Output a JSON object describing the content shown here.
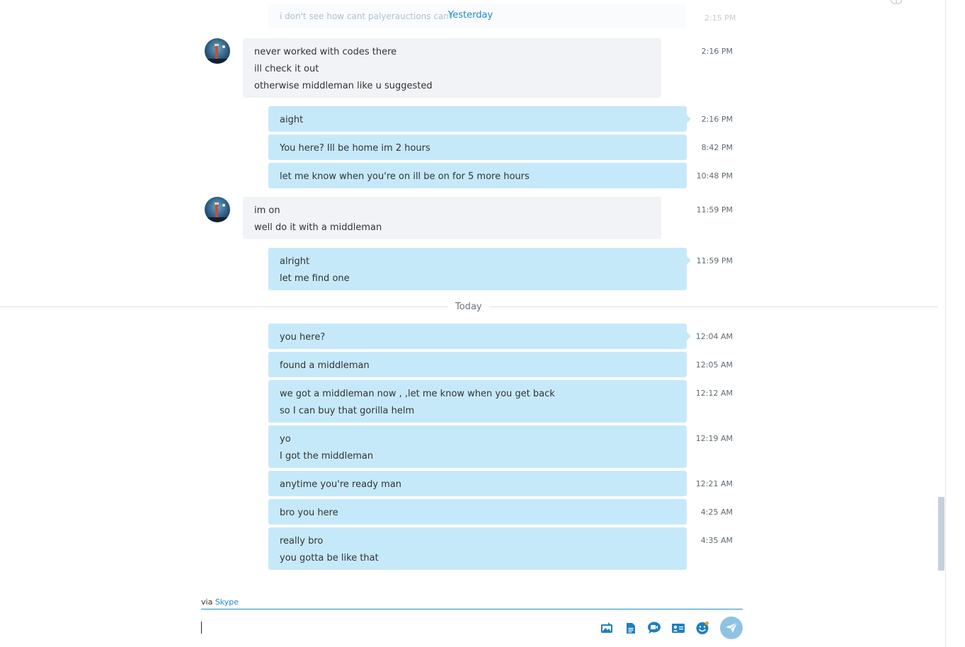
{
  "colors": {
    "accent": "#1b8dc9",
    "outgoing_bubble": "#c6e9fa",
    "incoming_bubble": "#f1f3f6",
    "send_button": "#8ec3e3"
  },
  "top_partial": {
    "faded_text": "i don't see how cant palyerauctions cant",
    "faded_time": "2:15 PM"
  },
  "dividers": {
    "yesterday": "Yesterday",
    "today": "Today"
  },
  "messages": [
    {
      "lines": [
        "never worked with codes there",
        "ill check it out",
        "otherwise middleman like u suggested"
      ],
      "time": "2:16 PM"
    },
    {
      "lines": [
        "aight"
      ],
      "time": "2:16 PM"
    },
    {
      "lines": [
        "You here? Ill be home im 2 hours"
      ],
      "time": "8:42 PM"
    },
    {
      "lines": [
        "let me know when you're on ill be on for 5 more hours"
      ],
      "time": "10:48 PM"
    },
    {
      "lines": [
        "im on",
        "well do it with a middleman"
      ],
      "time": "11:59 PM"
    },
    {
      "lines": [
        "alright",
        "let me find one"
      ],
      "time": "11:59 PM"
    },
    {
      "lines": [
        "you here?"
      ],
      "time": "12:04 AM"
    },
    {
      "lines": [
        "found a middleman"
      ],
      "time": "12:05 AM"
    },
    {
      "lines": [
        "we got a middleman now , ,let me know when you get back",
        "so I can buy that gorilla helm"
      ],
      "time": "12:12 AM"
    },
    {
      "lines": [
        "yo",
        "I got the middleman"
      ],
      "time": "12:19 AM"
    },
    {
      "lines": [
        "anytime you're ready man"
      ],
      "time": "12:21 AM"
    },
    {
      "lines": [
        "bro you here"
      ],
      "time": "4:25 AM"
    },
    {
      "lines": [
        "really bro",
        "you gotta be like that"
      ],
      "time": "4:35 AM"
    }
  ],
  "compose": {
    "via_prefix": "via",
    "via_service": "Skype",
    "tools": [
      "send-media-icon",
      "send-file-icon",
      "video-message-icon",
      "send-contact-icon",
      "emoticon-icon",
      "send-icon"
    ]
  }
}
